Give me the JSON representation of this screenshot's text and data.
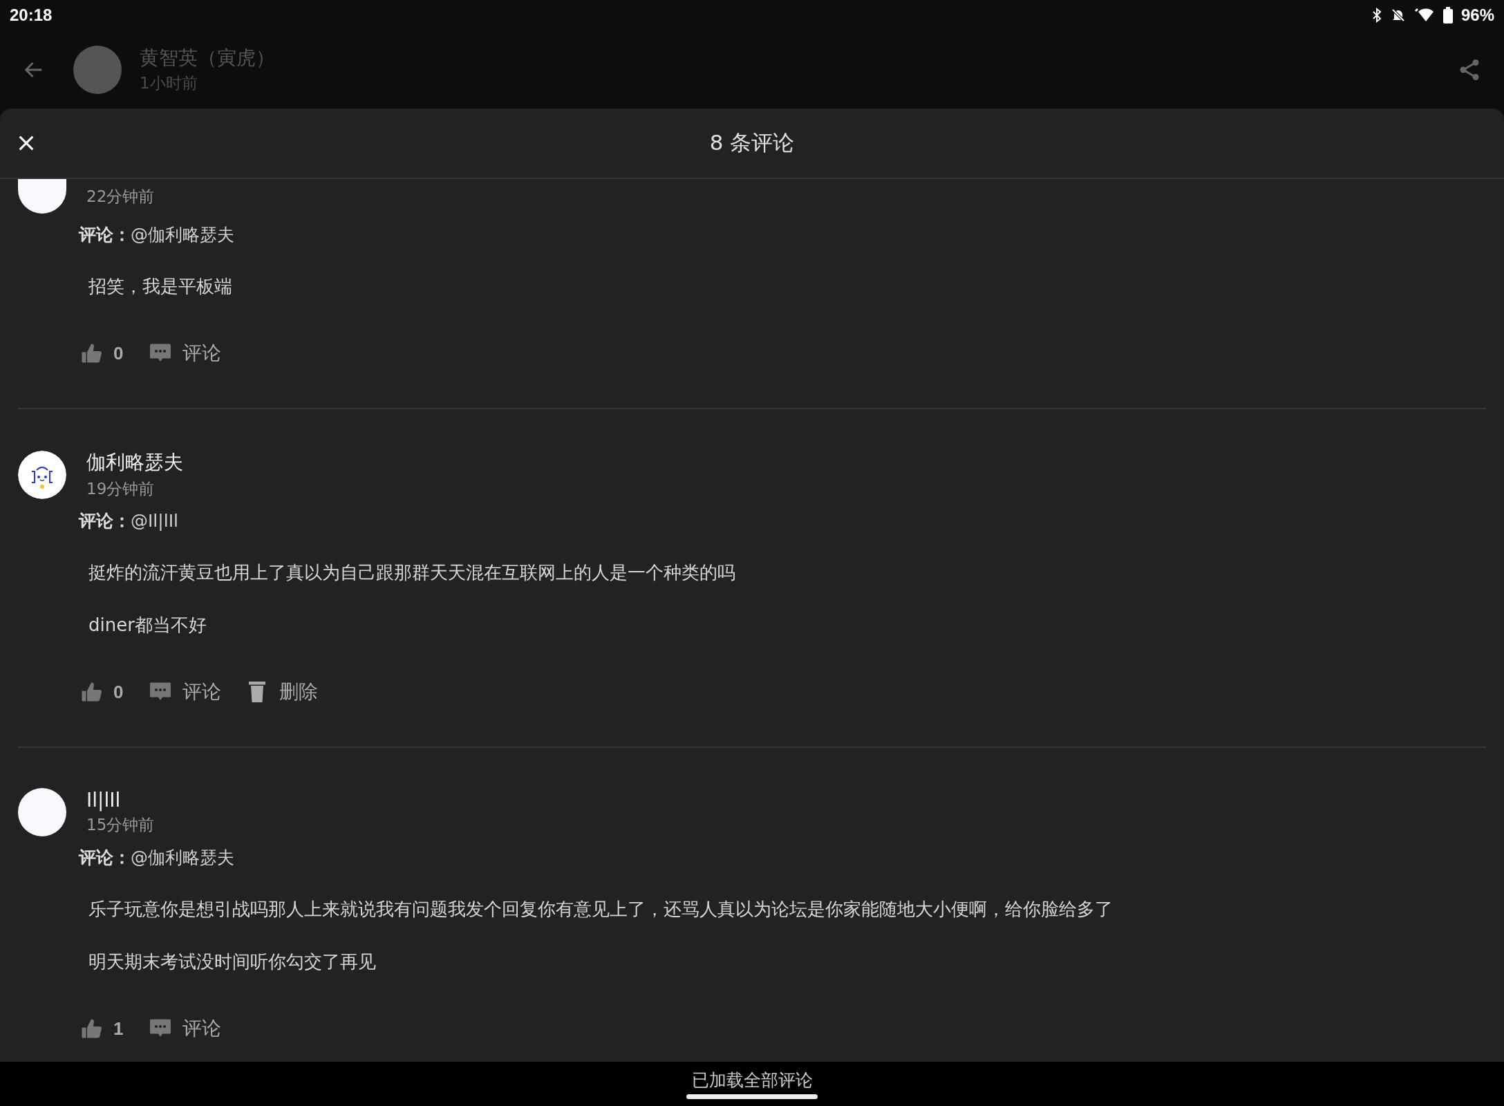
{
  "status_bar": {
    "time": "20:18",
    "battery": "96%"
  },
  "post_header": {
    "author": "黄智英（寅虎）",
    "time": "1小时前"
  },
  "comments_sheet": {
    "title": "8 条评论",
    "comments": [
      {
        "kind": "plain",
        "time": "22分钟前",
        "reply_label": "评论：",
        "reply_to": "@伽利略瑟夫",
        "paragraphs": [
          "招笑，我是平板端"
        ],
        "likes": "0",
        "comment_action": "评论"
      },
      {
        "kind": "drawing",
        "author": "伽利略瑟夫",
        "time": "19分钟前",
        "reply_label": "评论：",
        "reply_to": "@Il|lIl",
        "paragraphs": [
          "挺炸的流汗黄豆也用上了真以为自己跟那群天天混在互联网上的人是一个种类的吗",
          "diner都当不好"
        ],
        "likes": "0",
        "comment_action": "评论",
        "delete_action": "删除"
      },
      {
        "kind": "plain",
        "author": "Il|lIl",
        "time": "15分钟前",
        "reply_label": "评论：",
        "reply_to": "@伽利略瑟夫",
        "paragraphs": [
          "乐子玩意你是想引战吗那人上来就说我有问题我发个回复你有意见上了，还骂人真以为论坛是你家能随地大小便啊，给你脸给多了",
          "明天期末考试没时间听你勾交了再见"
        ],
        "likes": "1",
        "comment_action": "评论"
      }
    ]
  },
  "footer": {
    "text": "已加载全部评论"
  }
}
